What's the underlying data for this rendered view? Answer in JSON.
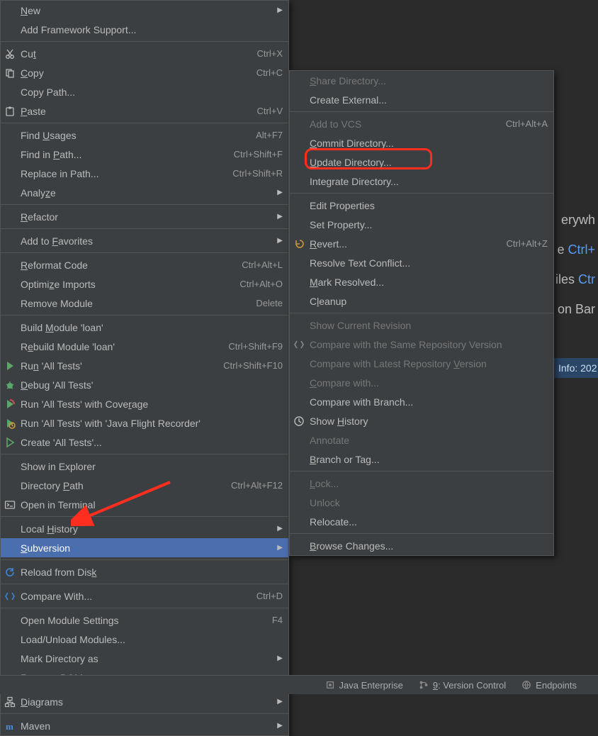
{
  "bg": {
    "hint1_text": "erywh",
    "hint2a": "e ",
    "hint2b": "Ctrl+",
    "hint3a": "iles ",
    "hint3b": "Ctr",
    "hint4": "on Bar"
  },
  "info_bar": "Info: 202",
  "menu1": {
    "items": [
      {
        "label": "New",
        "submenu": true,
        "u": "N"
      },
      {
        "label": "Add Framework Support..."
      },
      {
        "sep": true
      },
      {
        "icon": "cut-icon",
        "label": "Cut",
        "shortcut": "Ctrl+X",
        "u": "t",
        "upos": 2
      },
      {
        "icon": "copy-icon",
        "label": "Copy",
        "shortcut": "Ctrl+C",
        "u": "C"
      },
      {
        "label": "Copy Path..."
      },
      {
        "icon": "paste-icon",
        "label": "Paste",
        "shortcut": "Ctrl+V",
        "u": "P"
      },
      {
        "sep": true
      },
      {
        "label": "Find Usages",
        "shortcut": "Alt+F7",
        "u": "U",
        "upos": 5
      },
      {
        "label": "Find in Path...",
        "shortcut": "Ctrl+Shift+F",
        "u": "P",
        "upos": 8
      },
      {
        "label": "Replace in Path...",
        "shortcut": "Ctrl+Shift+R"
      },
      {
        "label": "Analyze",
        "submenu": true,
        "u": "z",
        "upos": 5
      },
      {
        "sep": true
      },
      {
        "label": "Refactor",
        "submenu": true,
        "u": "R"
      },
      {
        "sep": true
      },
      {
        "label": "Add to Favorites",
        "submenu": true,
        "u": "F",
        "upos": 7
      },
      {
        "sep": true
      },
      {
        "label": "Reformat Code",
        "shortcut": "Ctrl+Alt+L",
        "u": "R"
      },
      {
        "label": "Optimize Imports",
        "shortcut": "Ctrl+Alt+O",
        "u": "z",
        "upos": 6
      },
      {
        "label": "Remove Module",
        "shortcut": "Delete"
      },
      {
        "sep": true
      },
      {
        "label": "Build Module 'loan'",
        "u": "M",
        "upos": 6
      },
      {
        "label": "Rebuild Module 'loan'",
        "shortcut": "Ctrl+Shift+F9",
        "u": "e",
        "upos": 1
      },
      {
        "icon": "run-icon",
        "label": "Run 'All Tests'",
        "shortcut": "Ctrl+Shift+F10",
        "u": "n",
        "upos": 2
      },
      {
        "icon": "debug-icon",
        "label": "Debug 'All Tests'",
        "u": "D"
      },
      {
        "icon": "coverage-icon",
        "label": "Run 'All Tests' with Coverage",
        "u": "v",
        "upos": 25
      },
      {
        "icon": "profiler-icon",
        "label": "Run 'All Tests' with 'Java Flight Recorder'"
      },
      {
        "icon": "create-run-icon",
        "label": "Create 'All Tests'..."
      },
      {
        "sep": true
      },
      {
        "label": "Show in Explorer"
      },
      {
        "label": "Directory Path",
        "shortcut": "Ctrl+Alt+F12",
        "u": "P",
        "upos": 10
      },
      {
        "icon": "terminal-icon",
        "label": "Open in Terminal"
      },
      {
        "sep": true
      },
      {
        "label": "Local History",
        "submenu": true,
        "u": "H",
        "upos": 6
      },
      {
        "label": "Subversion",
        "submenu": true,
        "selected": true,
        "u": "S"
      },
      {
        "sep": true
      },
      {
        "icon": "reload-icon",
        "label": "Reload from Disk",
        "u": "k",
        "upos": 15
      },
      {
        "sep": true
      },
      {
        "icon": "diff-icon",
        "label": "Compare With...",
        "shortcut": "Ctrl+D"
      },
      {
        "sep": true
      },
      {
        "label": "Open Module Settings",
        "shortcut": "F4"
      },
      {
        "label": "Load/Unload Modules..."
      },
      {
        "label": "Mark Directory as",
        "submenu": true
      },
      {
        "label": "Remove BOM"
      },
      {
        "sep": true
      },
      {
        "icon": "diagrams-icon",
        "label": "Diagrams",
        "submenu": true,
        "u": "D"
      },
      {
        "sep": true
      },
      {
        "icon": "maven-icon",
        "label": "Maven",
        "submenu": true
      }
    ]
  },
  "menu2": {
    "items": [
      {
        "label": "Share Directory...",
        "disabled": true,
        "u": "S"
      },
      {
        "label": "Create External..."
      },
      {
        "sep": true
      },
      {
        "label": "Add to VCS",
        "shortcut": "Ctrl+Alt+A",
        "disabled": true
      },
      {
        "label": "Commit Directory...",
        "u": "C"
      },
      {
        "label": "Update Directory...",
        "u": "U",
        "highlight": true
      },
      {
        "label": "Integrate Directory..."
      },
      {
        "sep": true
      },
      {
        "label": "Edit Properties"
      },
      {
        "label": "Set Property..."
      },
      {
        "icon": "revert-icon",
        "label": "Revert...",
        "shortcut": "Ctrl+Alt+Z",
        "u": "R"
      },
      {
        "label": "Resolve Text Conflict..."
      },
      {
        "label": "Mark Resolved...",
        "u": "M"
      },
      {
        "label": "Cleanup",
        "u": "l",
        "upos": 1
      },
      {
        "sep": true
      },
      {
        "label": "Show Current Revision",
        "disabled": true
      },
      {
        "icon": "compare-icon",
        "label": "Compare with the Same Repository Version",
        "disabled": true
      },
      {
        "label": "Compare with Latest Repository Version",
        "disabled": true,
        "u": "V",
        "upos": 31
      },
      {
        "label": "Compare with...",
        "disabled": true,
        "u": "C"
      },
      {
        "label": "Compare with Branch..."
      },
      {
        "icon": "history-icon",
        "label": "Show History",
        "u": "H",
        "upos": 5
      },
      {
        "label": "Annotate",
        "disabled": true
      },
      {
        "label": "Branch or Tag...",
        "u": "B"
      },
      {
        "sep": true
      },
      {
        "label": "Lock...",
        "disabled": true,
        "u": "L"
      },
      {
        "label": "Unlock",
        "disabled": true
      },
      {
        "label": "Relocate..."
      },
      {
        "sep": true
      },
      {
        "label": "Browse Changes...",
        "u": "B"
      }
    ]
  },
  "statusbar": {
    "je": "Java Enterprise",
    "vc_underline": "9",
    "vc_label": ": Version Control",
    "ep": "Endpoints"
  }
}
